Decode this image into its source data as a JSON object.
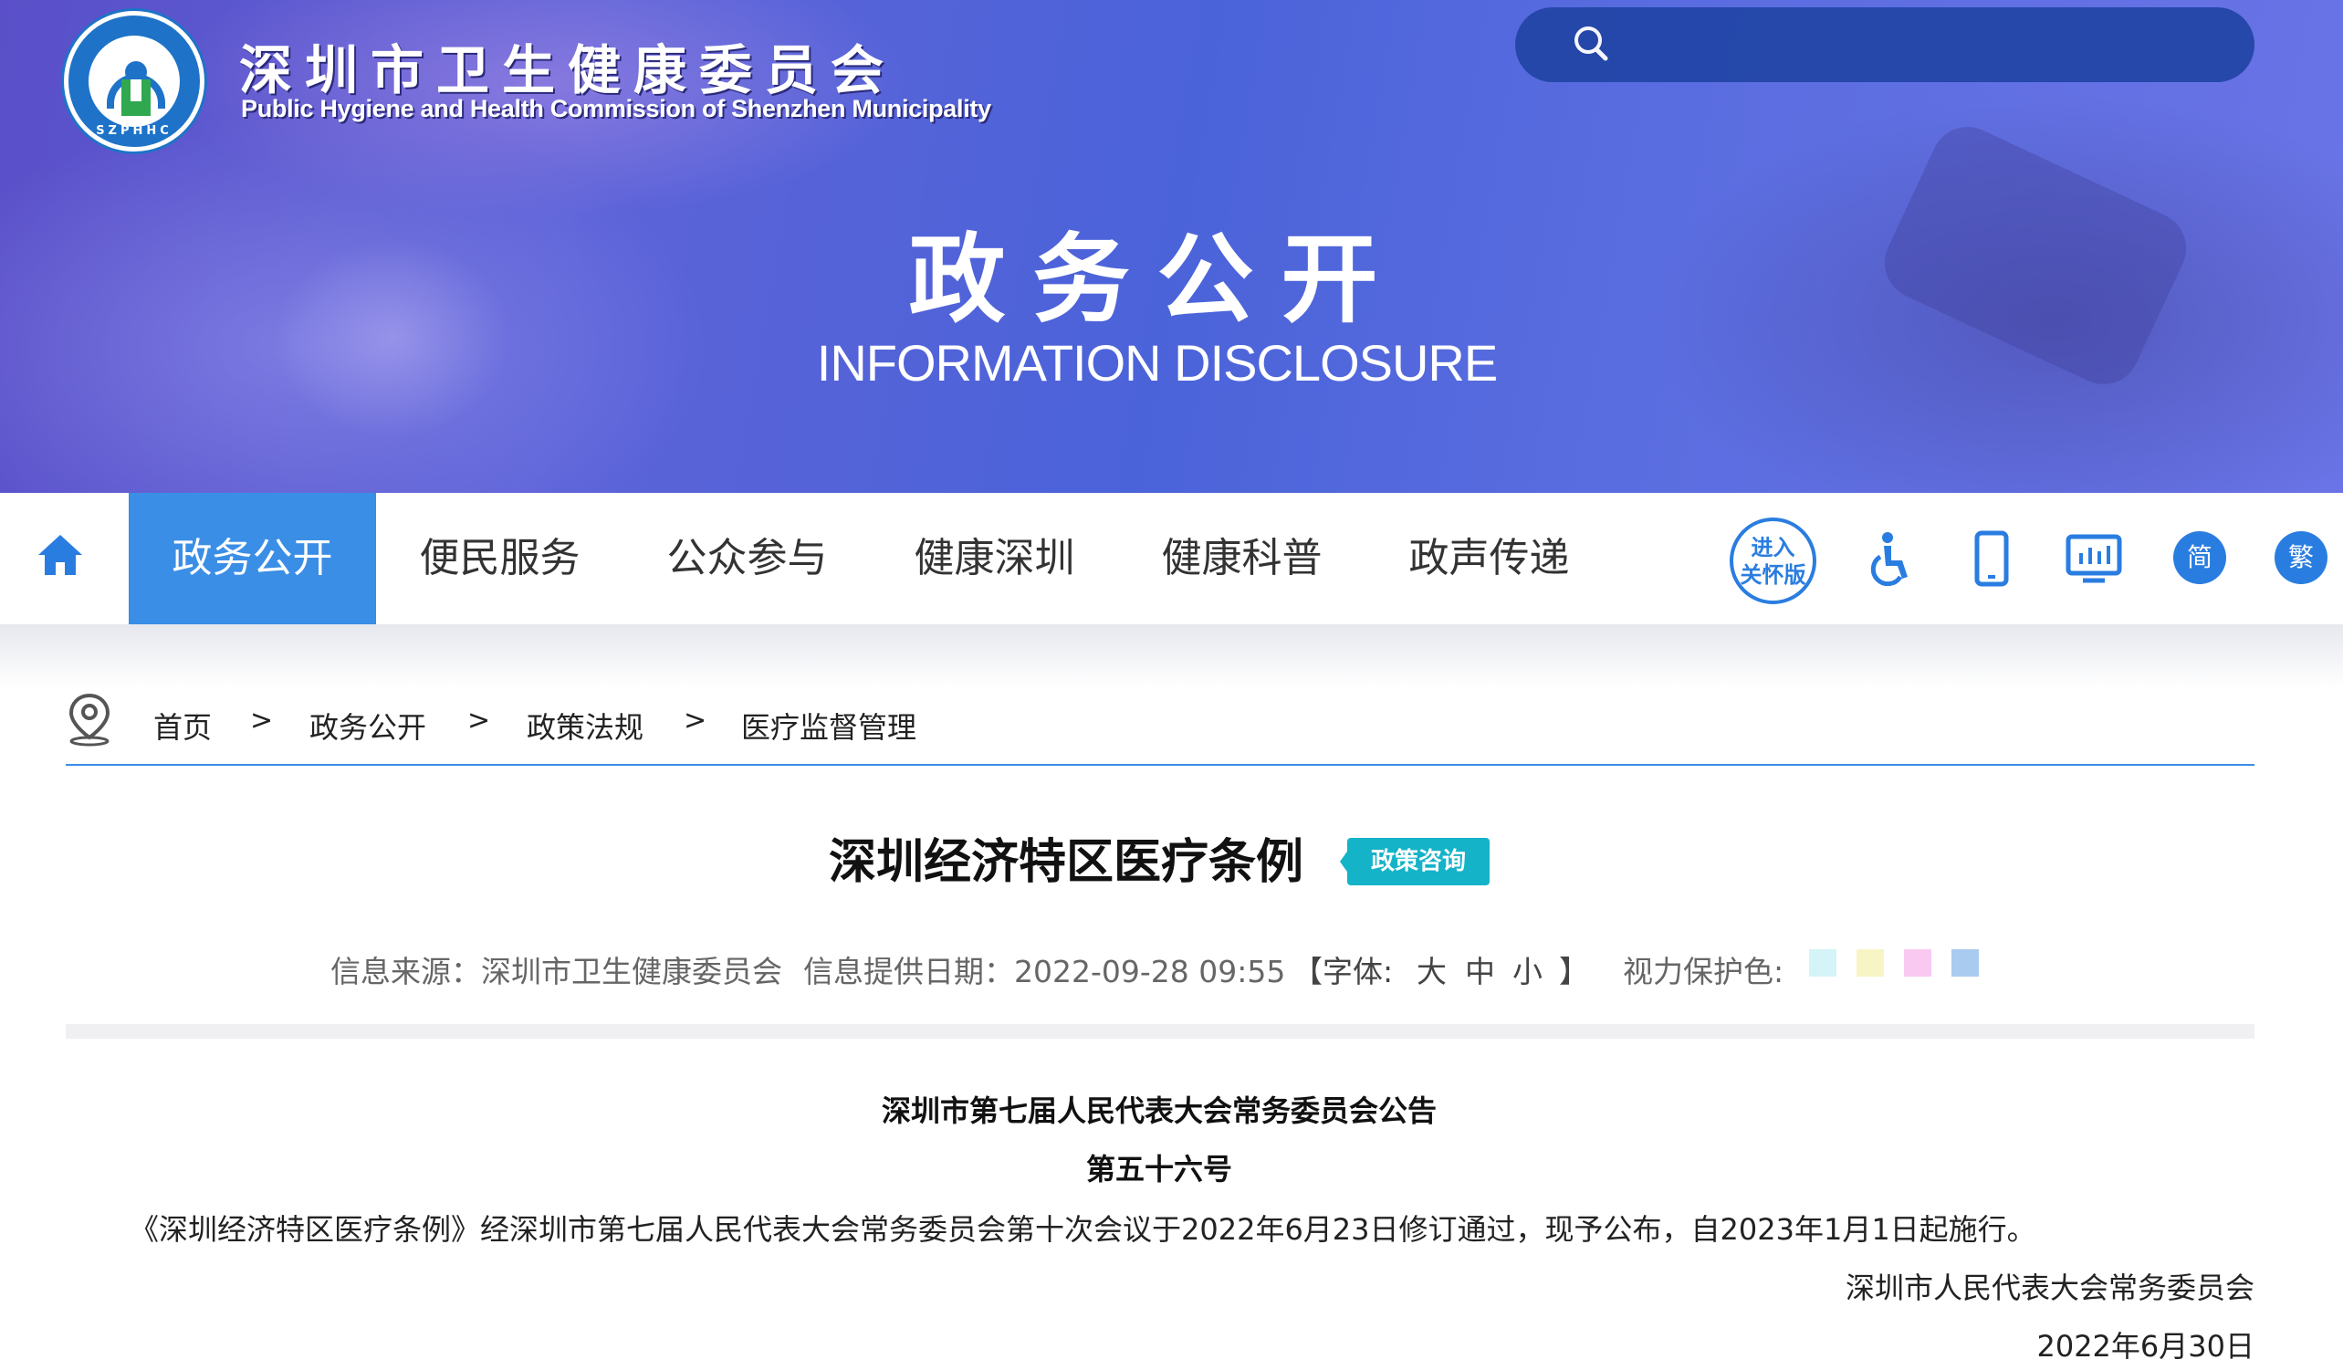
{
  "header": {
    "org_name_cn": "深圳市卫生健康委员会",
    "org_name_en": "Public Hygiene and Health Commission of Shenzhen Municipality",
    "logo_ring_text": "SZPHHC",
    "banner_title": "政务公开",
    "banner_subtitle": "INFORMATION DISCLOSURE"
  },
  "search": {
    "placeholder": ""
  },
  "nav": {
    "items": [
      {
        "label": "政务公开",
        "active": true
      },
      {
        "label": "便民服务"
      },
      {
        "label": "公众参与"
      },
      {
        "label": "健康深圳"
      },
      {
        "label": "健康科普"
      },
      {
        "label": "政声传递"
      }
    ],
    "care_mode_line1": "进入",
    "care_mode_line2": "关怀版",
    "simplified": "简",
    "traditional": "繁",
    "icons": [
      "home-icon",
      "accessibility-icon",
      "mobile-icon",
      "data-screen-icon"
    ]
  },
  "breadcrumb": {
    "items": [
      "首页",
      "政务公开",
      "政策法规",
      "医疗监督管理"
    ],
    "separator": ">"
  },
  "article": {
    "title": "深圳经济特区医疗条例",
    "badge": "政策咨询",
    "source_label": "信息来源：深圳市卫生健康委员会",
    "date_label": "信息提供日期：2022-09-28 09:55",
    "font_open": "【字体:",
    "font_large": "大",
    "font_medium": "中",
    "font_small": "小",
    "font_close": "】",
    "eye_care_label": "视力保护色:",
    "eye_care_colors": [
      "#d4f4f7",
      "#f7f5c5",
      "#f9c9f1",
      "#a9cbf0"
    ],
    "heading1": "深圳市第七届人民代表大会常务委员会公告",
    "heading2": "第五十六号",
    "paragraph": "《深圳经济特区医疗条例》经深圳市第七届人民代表大会常务委员会第十次会议于2022年6月23日修订通过，现予公布，自2023年1月1日起施行。",
    "signature": "深圳市人民代表大会常务委员会",
    "sign_date": "2022年6月30日"
  },
  "colors": {
    "accent": "#3a8ee6",
    "badge": "#14b3c8",
    "search_bg": "#2346a8"
  }
}
